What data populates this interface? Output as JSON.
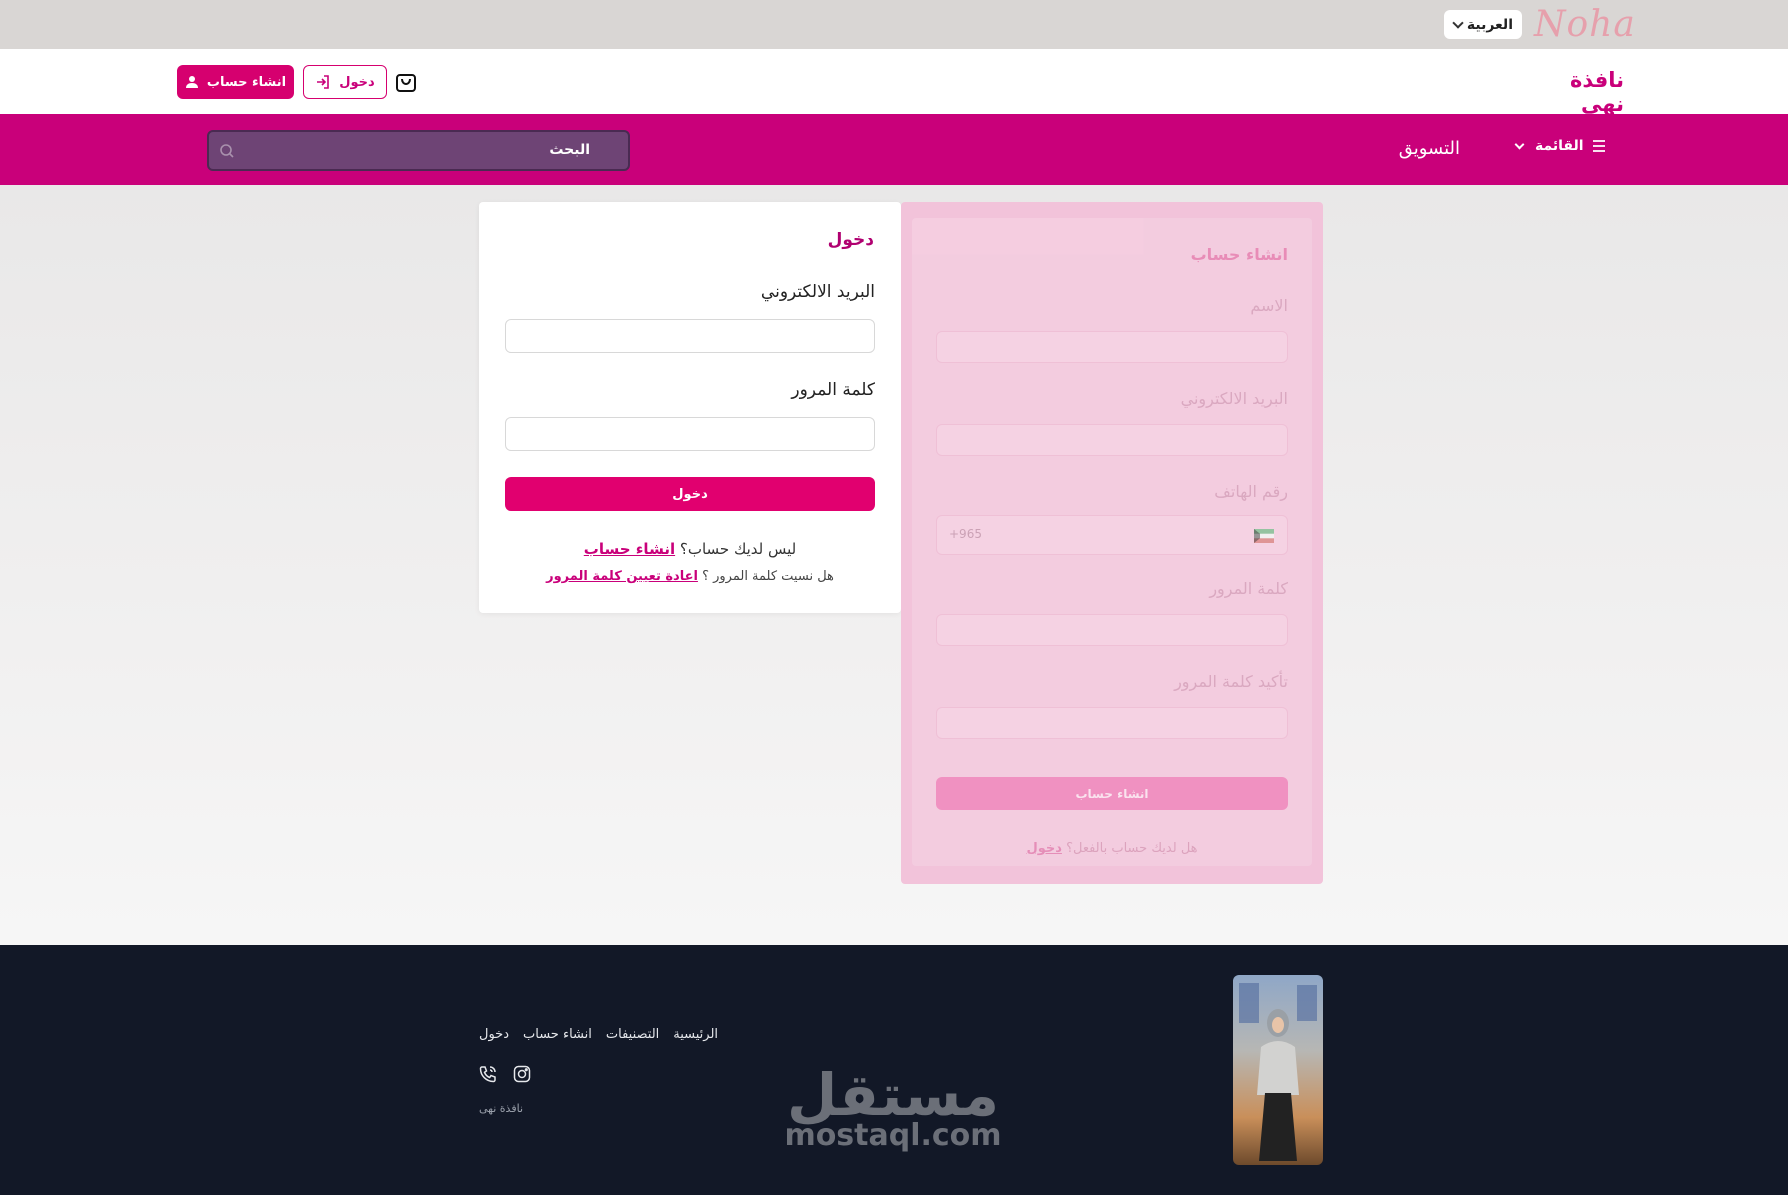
{
  "top": {
    "logo_text": "Noha",
    "language": "العربية"
  },
  "header": {
    "brand": "نافذة نهى",
    "signup_label": "انشاء حساب",
    "login_label": "دخول"
  },
  "nav": {
    "search_placeholder": "البحث",
    "marketing": "التسويق",
    "menu": "القائمة"
  },
  "login": {
    "title": "دخول",
    "email_label": "البريد الالكتروني",
    "email_value": "",
    "password_label": "كلمة المرور",
    "password_value": "",
    "submit": "دخول",
    "no_account": "ليس لديك حساب؟",
    "create_account_link": "انشاء حساب",
    "forgot": "هل نسيت كلمة المرور ؟",
    "reset_link": "اعادة تعيين كلمة المرور"
  },
  "signup": {
    "title": "انشاء حساب",
    "name_label": "الاسم",
    "email_label": "البريد الالكتروني",
    "phone_label": "رقم الهاتف",
    "phone_code": "+965",
    "password_label": "كلمة المرور",
    "confirm_label": "تأكيد كلمة المرور",
    "submit": "انشاء حساب",
    "have_account": "هل لديك حساب بالفعل؟",
    "login_link": "دخول"
  },
  "footer": {
    "links": [
      "الرئيسية",
      "التصنيفات",
      "انشاء حساب",
      "دخول"
    ],
    "brand": "نافذة نهى",
    "watermark_ar": "مستقل",
    "watermark_en": "mostaql.com"
  },
  "colors": {
    "primary": "#c9007a",
    "button": "#e1006f",
    "footer_bg": "#121827"
  }
}
